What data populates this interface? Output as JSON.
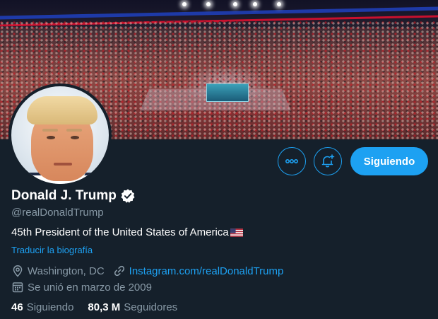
{
  "profile": {
    "display_name": "Donald J. Trump",
    "handle": "@realDonaldTrump",
    "bio": "45th President of the United States of America",
    "bio_flag_icon": "us-flag-icon",
    "translate_label": "Traducir la biografía",
    "location": "Washington, DC",
    "website": "Instagram.com/realDonaldTrump",
    "joined": "Se unió en marzo de 2009",
    "verified": true
  },
  "actions": {
    "more_icon": "more-options-icon",
    "notify_icon": "bell-plus-icon",
    "follow_label": "Siguiendo"
  },
  "stats": {
    "following_count": "46",
    "following_label": "Siguiendo",
    "followers_count": "80,3 M",
    "followers_label": "Seguidores"
  },
  "icons": {
    "location": "location-pin-icon",
    "website": "link-icon",
    "joined": "calendar-icon",
    "verified": "verified-badge-icon"
  },
  "colors": {
    "background": "#15202b",
    "accent": "#1da1f2",
    "secondary_text": "#8899a6",
    "primary_text": "#ffffff"
  }
}
